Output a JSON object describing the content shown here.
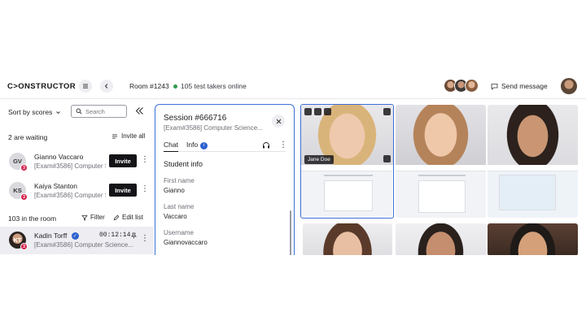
{
  "header": {
    "logo": "C>ONSTRUCTOR",
    "room": "Room #1243",
    "online": "105 test takers online",
    "send_message": "Send message",
    "online_dot_color": "#2e9b4f"
  },
  "left": {
    "sort_label": "Sort by scores",
    "search_placeholder": "Search",
    "waiting_title": "2 are waiting",
    "invite_all": "Invite all",
    "waiting": [
      {
        "initials": "GV",
        "name": "Gianno Vaccaro",
        "exam": "[Exam#3586] Computer Science...",
        "badge": "3",
        "button": "Invite"
      },
      {
        "initials": "KS",
        "name": "Kaiya Stanton",
        "exam": "[Exam#3586] Computer Science...",
        "badge": "3",
        "button": "Invite"
      }
    ],
    "room_title": "103 in the room",
    "filter": "Filter",
    "edit_list": "Edit list",
    "in_room": [
      {
        "initials": "KT",
        "name": "Kadin Torff",
        "exam": "[Exam#3586] Computer Science...",
        "badge": "3",
        "timer": "00:12:14"
      }
    ]
  },
  "session": {
    "title": "Session #666716",
    "subtitle": "[Exam#3586] Computer Science...",
    "tabs": [
      {
        "label": "Chat"
      },
      {
        "label": "Info",
        "badge": "i"
      }
    ],
    "section": "Student info",
    "fields": [
      {
        "label": "First name",
        "value": "Gianno"
      },
      {
        "label": "Last name",
        "value": "Vaccaro"
      },
      {
        "label": "Username",
        "value": "Giannovaccaro"
      }
    ]
  },
  "grid": {
    "selected_name": "Jane Doe",
    "accent": "#3c6fd8"
  }
}
